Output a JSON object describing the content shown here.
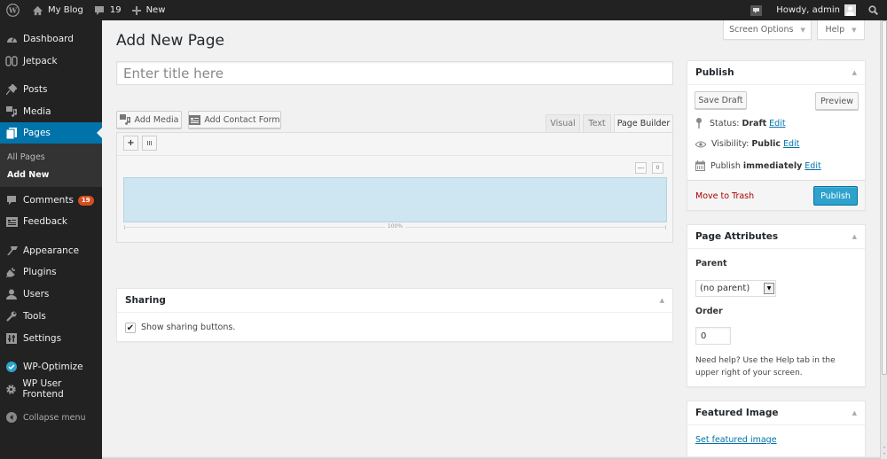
{
  "adminbar": {
    "wp_logo_icon": "wordpress-logo-icon",
    "site_name": "My Blog",
    "comments_count": "19",
    "new_label": "New",
    "howdy": "Howdy, admin"
  },
  "screen_options": {
    "screen_options_label": "Screen Options",
    "help_label": "Help"
  },
  "sidebar": {
    "items": [
      {
        "label": "Dashboard",
        "icon": "dashboard-icon"
      },
      {
        "label": "Jetpack",
        "icon": "jetpack-icon"
      },
      {
        "label": "Posts",
        "icon": "pushpin-icon"
      },
      {
        "label": "Media",
        "icon": "media-icon"
      },
      {
        "label": "Pages",
        "icon": "pages-icon",
        "current": true
      },
      {
        "label": "Comments",
        "icon": "comment-icon",
        "badge": "19"
      },
      {
        "label": "Feedback",
        "icon": "feedback-icon"
      },
      {
        "label": "Appearance",
        "icon": "paintbrush-icon"
      },
      {
        "label": "Plugins",
        "icon": "plugin-icon"
      },
      {
        "label": "Users",
        "icon": "users-icon"
      },
      {
        "label": "Tools",
        "icon": "wrench-icon"
      },
      {
        "label": "Settings",
        "icon": "settings-icon"
      },
      {
        "label": "WP-Optimize",
        "icon": "check-circle-icon"
      },
      {
        "label": "WP User Frontend",
        "icon": "gear-icon"
      }
    ],
    "submenu": [
      {
        "label": "All Pages"
      },
      {
        "label": "Add New",
        "current": true
      }
    ],
    "collapse_label": "Collapse menu"
  },
  "main": {
    "page_title": "Add New Page",
    "title_placeholder": "Enter title here",
    "title_value": "",
    "add_media_label": "Add Media",
    "add_contact_form_label": "Add Contact Form",
    "editor_tabs": [
      {
        "label": "Visual",
        "active": false
      },
      {
        "label": "Text",
        "active": false
      },
      {
        "label": "Page Builder",
        "active": true
      }
    ],
    "page_builder": {
      "add_widget_label": "+",
      "add_row_label": "III",
      "row_collapse_label": "—",
      "row_delete_label": "0",
      "cell_width_label": "100%"
    },
    "sharing": {
      "title": "Sharing",
      "checkbox_label": "Show sharing buttons.",
      "checked": true
    }
  },
  "publish_box": {
    "title": "Publish",
    "save_draft_label": "Save Draft",
    "preview_label": "Preview",
    "status_label": "Status:",
    "status_value": "Draft",
    "visibility_label": "Visibility:",
    "visibility_value": "Public",
    "publish_label": "Publish",
    "publish_value": "immediately",
    "edit_label": "Edit",
    "trash_label": "Move to Trash",
    "publish_button_label": "Publish"
  },
  "page_attributes": {
    "title": "Page Attributes",
    "parent_label": "Parent",
    "parent_selected": "(no parent)",
    "order_label": "Order",
    "order_value": "0",
    "help_text": "Need help? Use the Help tab in the upper right of your screen."
  },
  "featured_image": {
    "title": "Featured Image",
    "set_link_label": "Set featured image"
  },
  "colors": {
    "accent": "#0073aa",
    "publish_button": "#2ea2cc",
    "badge": "#d54e21",
    "trash": "#aa0000",
    "cell_background": "#cde6f1"
  }
}
